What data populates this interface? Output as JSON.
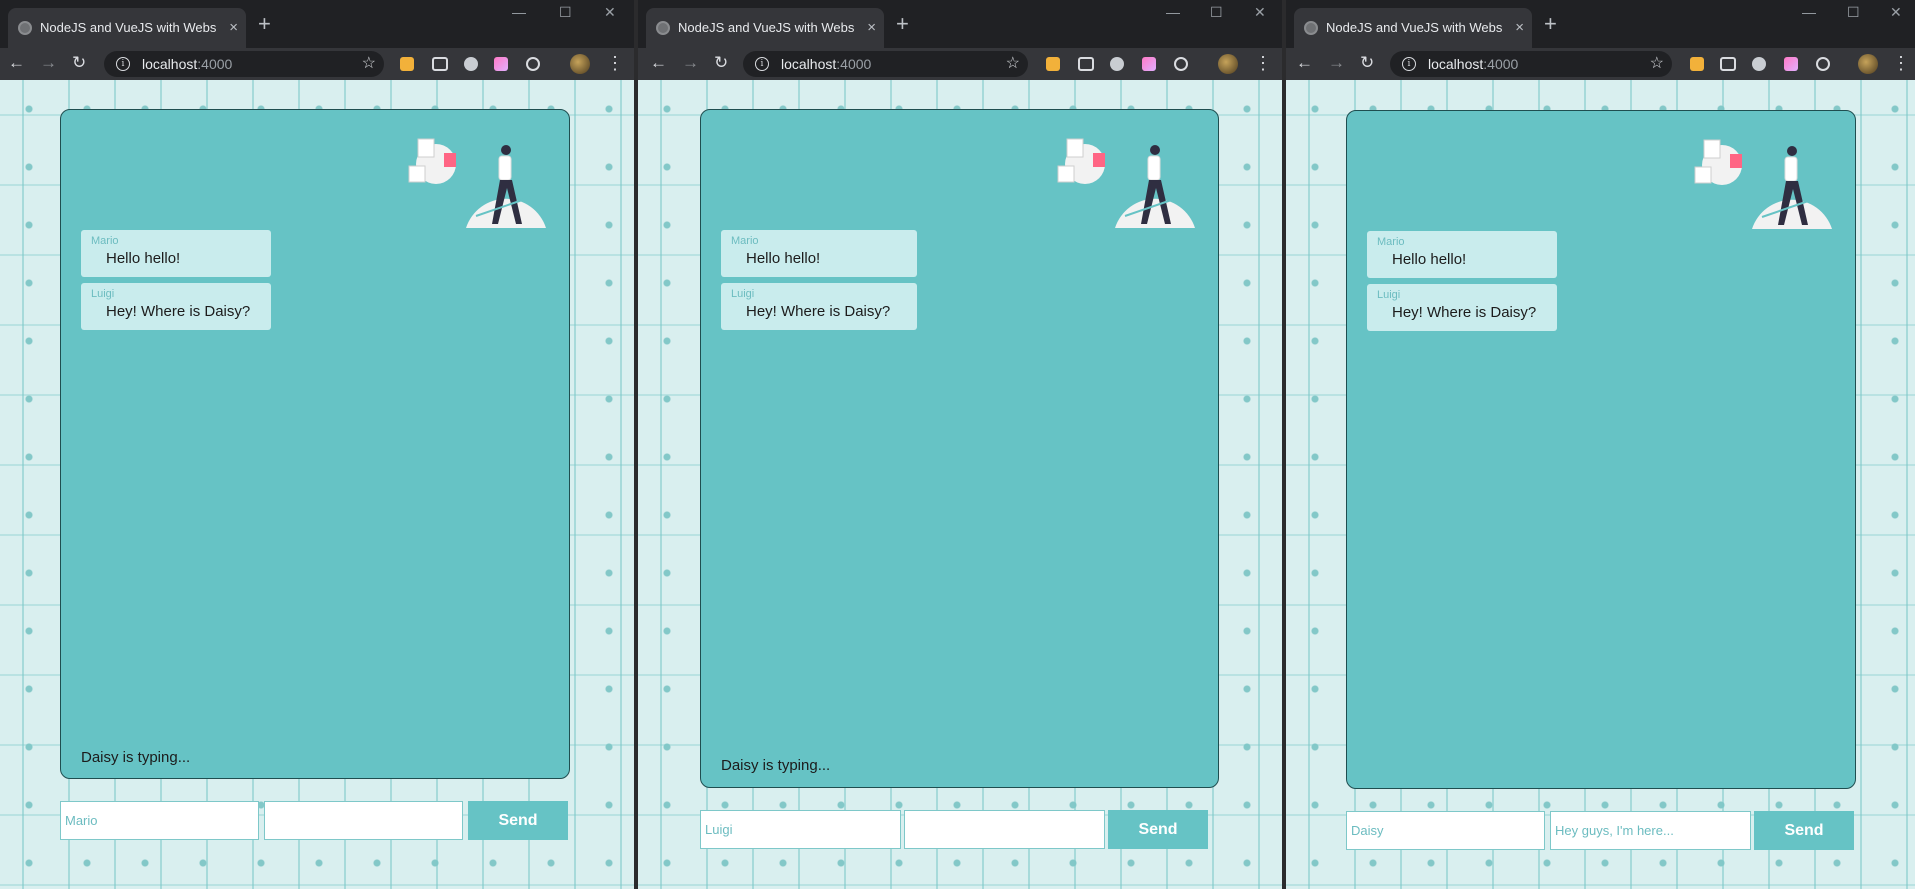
{
  "browser": {
    "tab_title": "NodeJS and VueJS with Websockets",
    "tab_close": "×",
    "new_tab": "+",
    "url_host": "localhost",
    "url_port": ":4000",
    "minimize": "—",
    "maximize": "☐",
    "close": "✕"
  },
  "windows": [
    {
      "messages": [
        {
          "user": "Mario",
          "text": "Hello hello!"
        },
        {
          "user": "Luigi",
          "text": "Hey! Where is Daisy?"
        }
      ],
      "typing": "Daisy is typing...",
      "name_value": "Mario",
      "message_placeholder": "",
      "send_label": "Send"
    },
    {
      "messages": [
        {
          "user": "Mario",
          "text": "Hello hello!"
        },
        {
          "user": "Luigi",
          "text": "Hey! Where is Daisy?"
        }
      ],
      "typing": "Daisy is typing...",
      "name_value": "Luigi",
      "message_placeholder": "",
      "send_label": "Send"
    },
    {
      "messages": [
        {
          "user": "Mario",
          "text": "Hello hello!"
        },
        {
          "user": "Luigi",
          "text": "Hey! Where is Daisy?"
        }
      ],
      "typing": "",
      "name_value": "Daisy",
      "message_placeholder": "Hey guys, I'm here...",
      "send_label": "Send"
    }
  ],
  "colors": {
    "chat_background": "#66c3c5",
    "message_bubble": "#c9eced",
    "page_background": "#d9efef",
    "accent": "#66c3c5"
  },
  "icons": [
    "back-arrow-icon",
    "forward-arrow-icon",
    "reload-icon",
    "info-icon",
    "star-icon",
    "kebab-menu-icon",
    "chat-illustration"
  ]
}
